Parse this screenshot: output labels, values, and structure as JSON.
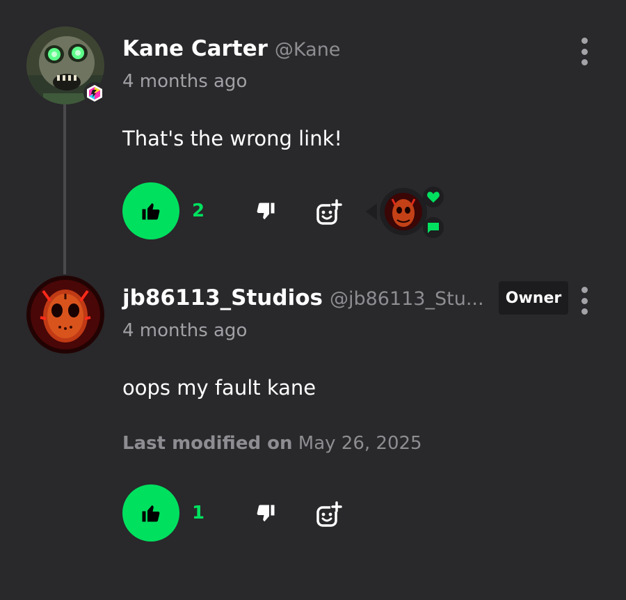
{
  "comments": [
    {
      "author": "Kane Carter",
      "handle": "@Kane",
      "time": "4 months ago",
      "text": "That's the wrong link!",
      "likes": "2"
    },
    {
      "author": "jb86113_Studios",
      "handle": "@jb86113_Stu...",
      "badge": "Owner",
      "time": "4 months ago",
      "text": "oops my fault kane",
      "modified_label": "Last modified on",
      "modified_date": "May 26, 2025",
      "likes": "1"
    }
  ],
  "colors": {
    "accent": "#00e05f",
    "background": "#29282b",
    "owner_badge_bg": "#1c1b1d"
  },
  "icons": [
    "thumbs-up-icon",
    "thumbs-down-icon",
    "add-reaction-icon",
    "more-options-icon",
    "heart-icon",
    "chat-bubble-icon",
    "creator-badge-icon"
  ]
}
